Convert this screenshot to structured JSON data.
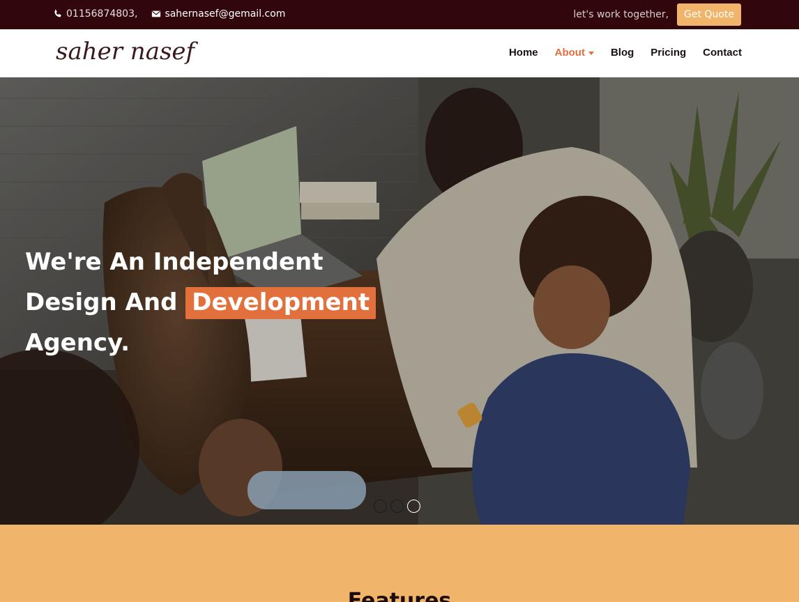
{
  "topbar": {
    "phone": "01156874803",
    "separator": ",",
    "email": "sahernasef@gemail.com",
    "tagline": "let's work together,",
    "quote_label": "Get Quote"
  },
  "header": {
    "logo": "saher nasef",
    "nav": {
      "home": "Home",
      "about": "About",
      "blog": "Blog",
      "pricing": "Pricing",
      "contact": "Contact"
    }
  },
  "hero": {
    "line1": "We're An Independent",
    "line2_prefix": "Design And",
    "line2_highlight": "Development",
    "line3": "Agency.",
    "slides": 3,
    "active_slide": 3
  },
  "features": {
    "title": "Features"
  },
  "colors": {
    "topbar_bg": "#32070b",
    "accent": "#e2703c",
    "quote_btn": "#f0b56b",
    "features_bg": "#f0b56b"
  },
  "icons": [
    "phone-icon",
    "envelope-icon",
    "caret-down-icon"
  ]
}
